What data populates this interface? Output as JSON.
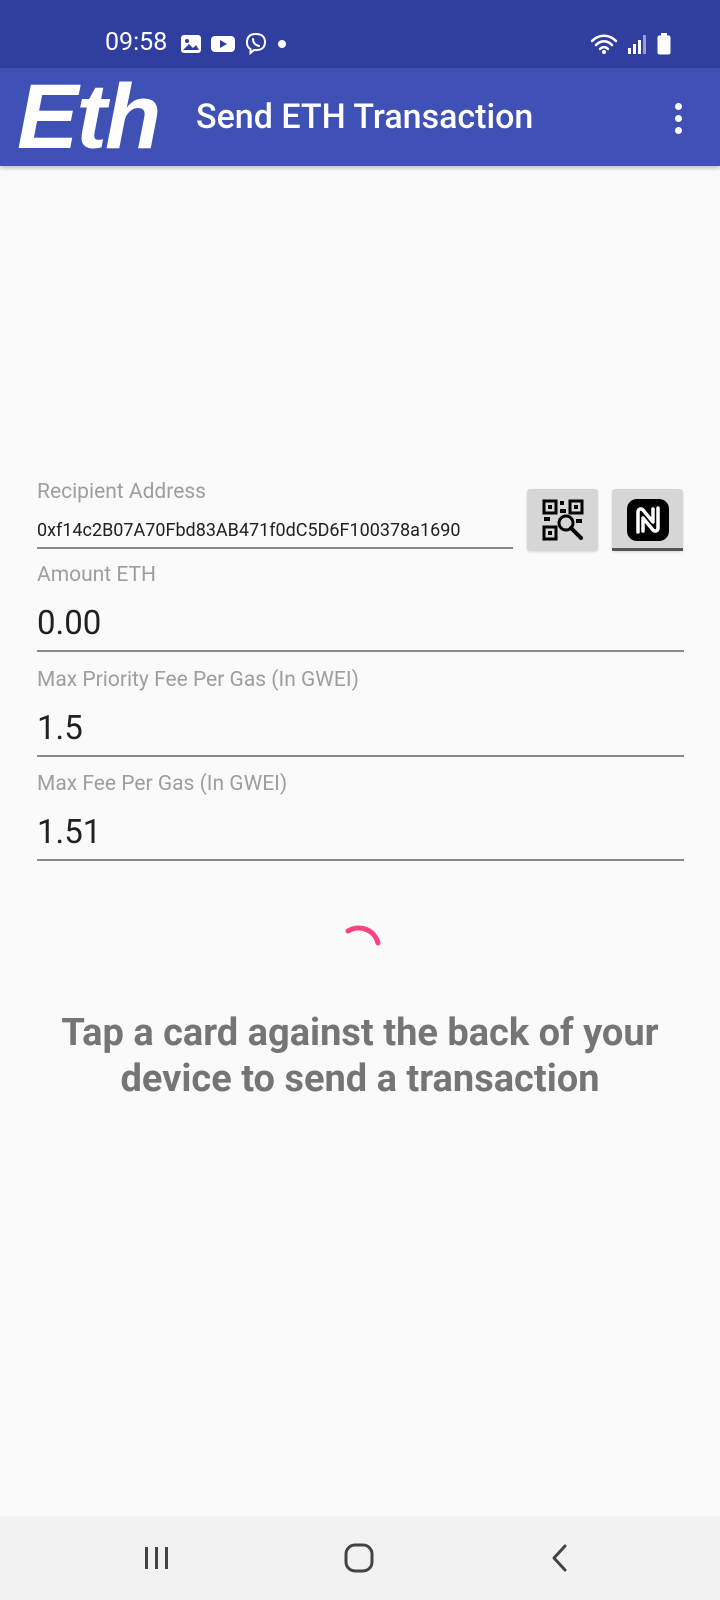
{
  "status_bar": {
    "time": "09:58",
    "left_icons": [
      "gallery-icon",
      "youtube-icon",
      "viber-icon",
      "notification-dot-icon"
    ],
    "right_icons": [
      "wifi-icon",
      "signal-icon",
      "battery-icon"
    ]
  },
  "app_bar": {
    "logo_text": "Eth",
    "title": "Send ETH Transaction",
    "menu_icon": "overflow-menu-icon"
  },
  "form": {
    "recipient": {
      "label": "Recipient Address",
      "value": "0xf14c2B07A70Fbd83AB471f0dC5D6F100378a1690",
      "qr_icon": "qr-scan-icon",
      "nfc_icon": "nfc-icon"
    },
    "amount": {
      "label": "Amount ETH",
      "value": "0.00"
    },
    "max_priority_fee": {
      "label": "Max Priority Fee Per Gas (In GWEI)",
      "value": "1.5"
    },
    "max_fee": {
      "label": "Max Fee Per Gas (In GWEI)",
      "value": "1.51"
    }
  },
  "prompt": {
    "text": "Tap a card against the back of your device to send a transaction"
  },
  "nav_bar": {
    "icons": [
      "recents-icon",
      "home-icon",
      "back-icon"
    ]
  },
  "colors": {
    "status_bar": "#303f9f",
    "app_bar": "#3f51b5",
    "spinner": "#ff4081",
    "label": "#9e9e9e",
    "prompt": "#757575"
  }
}
